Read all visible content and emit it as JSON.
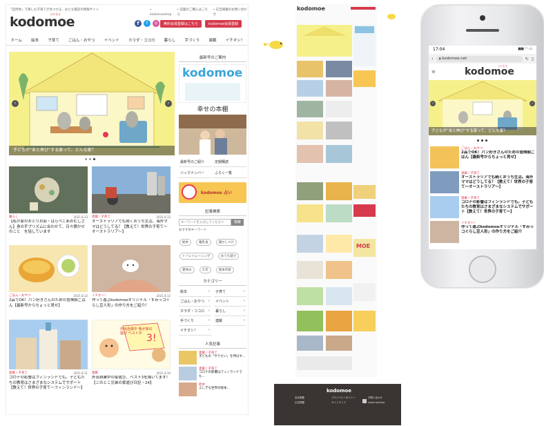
{
  "desktop": {
    "top_tagline": "「自然体」で楽しむ子育てが見つかる、おとな雑誌の情報サイト",
    "top_links": [
      "• kodomoeshop",
      "• 誌面のご購入はこちら",
      "• 広告掲載のお問い合わせ"
    ],
    "logo": "kodomoe",
    "logo_ruby": "コドモエ",
    "social_icons": [
      "facebook-icon",
      "twitter-icon",
      "instagram-icon"
    ],
    "btn_newsletter": "無料会員登録はこちら",
    "btn_login": "kodomoe会員登録",
    "nav": [
      "ホーム",
      "絵本",
      "子育て",
      "ごはん・おやつ",
      "イベント",
      "カラダ・ココロ",
      "暮らし",
      "手づくり",
      "連載",
      "イチオシ！"
    ],
    "hero_caption": "子どもが“あと伸び”する家って、どんな家？",
    "sidebar": {
      "latest_issue_head": "最新号のご案内",
      "magazine_title": "kodomoe",
      "book_title": "幸せの本棚",
      "book_links": [
        "最新号のご紹介",
        "定期購読",
        "バックナンバー",
        "ふろく一覧"
      ],
      "banner_text": "kodomoe 占い",
      "search_head": "記事検索",
      "search_placeholder": "キーワードを入力してください",
      "search_button": "検索",
      "keywords_label": "おすすめキーワード",
      "keywords": [
        "絵本",
        "離乳食",
        "寝かしつけ",
        "トイレトレーニング",
        "おうち遊び",
        "夏休み",
        "工作",
        "絵本作家"
      ],
      "category_head": "カテゴリー",
      "categories": [
        [
          "絵本",
          "子育て"
        ],
        [
          "ごはん・おやつ",
          "イベント"
        ],
        [
          "カラダ・ココロ",
          "暮らし"
        ],
        [
          "手づくり",
          "連載"
        ],
        [
          "イチオシ！",
          ""
        ]
      ],
      "ranking_head": "人気記事",
      "ranking": [
        {
          "tag": "連載 / 子育て",
          "title": "子どもの「やりたい」を伸ばす…"
        },
        {
          "tag": "連載 / 子育て",
          "title": "コロナの影響はフィンランドでも…"
        },
        {
          "tag": "絵本",
          "title": "ふしぎな世界の絵本…"
        }
      ]
    },
    "articles": [
      {
        "tag": "暮らし",
        "date": "2021.8.13",
        "title": "【私が家のおとりお皿・はらぺこあおむしさん】身の手プリズムに合わせて、日々寝かせのこと　を話しています"
      },
      {
        "tag": "連載 / 子育て",
        "date": "2021.8.13",
        "title": "オーストラリアでも続くおうち生活、海外ママはどうしてる？【教えて！世界の子育て～オーストラリア～】"
      },
      {
        "tag": "ごはん・おやつ",
        "date": "2021.8.12",
        "title": "2品でOK！パン好きさんのための冒険朝ごはん【最新号からちょっと見せ】"
      },
      {
        "tag": "イチオシ！",
        "date": "2021.8.12",
        "title": "作って遊ぶkodomoeオリジナル「すみっコぐらし豆人形」の作り方をご紹介！"
      },
      {
        "tag": "連載 / 子育て",
        "date": "2021.8.11",
        "title": "コロナの影響はフィンランドでも。子どもたちの教育はさまざまなシステムでサポート【教えて！世界の子育て～フィンランド～】"
      },
      {
        "tag": "連載",
        "date": "2021.8.10",
        "title": "外出自粛中の家遊び、ベスト3を描いてます！【このとこ兄弟の家遊び日記・24】"
      }
    ],
    "comic_text": "外出自粛中 我が家の遊び ベスト3!"
  },
  "longpage": {
    "logo": "kodomoe",
    "banner_label": "MOE"
  },
  "footer": {
    "logo": "kodomoe",
    "links": [
      "会社概要",
      "プライバシーポリシー",
      "お問い合わせ",
      "広告掲載",
      "サイトマップ",
      "kodomoeshop"
    ]
  },
  "phone": {
    "time": "17:04",
    "status_icons": "▮▮▮ ◠ ▭",
    "url": "kodomoe.net",
    "logo": "kodomoe",
    "logo_ruby": "コドモエ",
    "hero_caption": "子どもが“あと伸び”する家って、どんな家？",
    "items": [
      {
        "tag": "ごはん・おやつ",
        "title": "2品でOK！パン好きさんのための冒険朝ごはん【最新号からちょっと見せ】"
      },
      {
        "tag": "連載 / 子育て",
        "title": "オーストラリアでも続くおうち生活。海外ママはどうしてる？【教えて！世界の子育て～オーストラリア～】"
      },
      {
        "tag": "連載 / 子育て",
        "title": "コロナの影響はフィンランドでも。子どもたちの教育はさまざまなシステムでサポート【教えて！世界の子育て～】"
      },
      {
        "tag": "イチオシ！",
        "title": "作って遊ぶkodomoeオリジナル「すみっコぐらし豆人形」の作り方をご紹介"
      }
    ]
  },
  "colors": {
    "brand_red": "#d63a4c",
    "hero_yellow": "#f6f08a",
    "footer_brown": "#3a3532"
  }
}
